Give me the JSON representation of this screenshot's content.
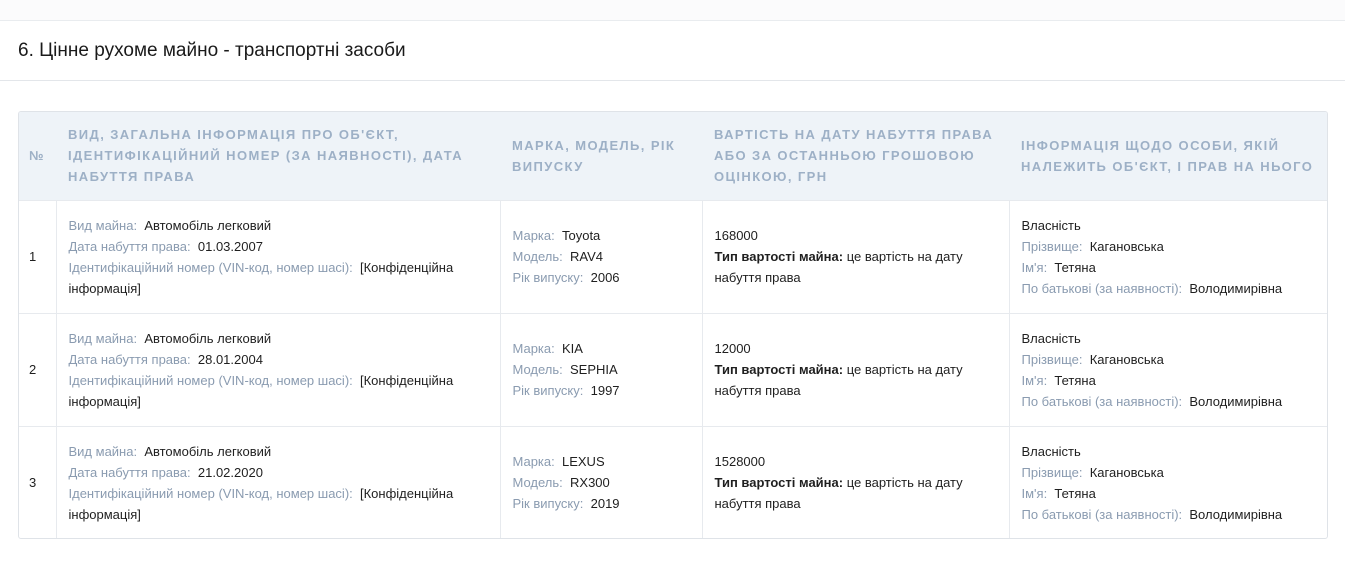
{
  "section": {
    "title": "6. Цінне рухоме майно - транспортні засоби"
  },
  "table": {
    "headers": {
      "num": "№",
      "info": "ВИД, ЗАГАЛЬНА ІНФОРМАЦІЯ ПРО ОБ'ЄКТ, ІДЕНТИФІКАЦІЙНИЙ НОМЕР (ЗА НАЯВНОСТІ), ДАТА НАБУТТЯ ПРАВА",
      "model": "МАРКА, МОДЕЛЬ, РІК ВИПУСКУ",
      "value": "ВАРТІСТЬ НА ДАТУ НАБУТТЯ ПРАВА АБО ЗА ОСТАННЬОЮ ГРОШОВОЮ ОЦІНКОЮ, ГРН",
      "owner": "ІНФОРМАЦІЯ ЩОДО ОСОБИ, ЯКІЙ НАЛЕЖИТЬ ОБ'ЄКТ, І ПРАВ НА НЬОГО"
    },
    "labels": {
      "kind": "Вид майна:",
      "date": "Дата набуття права:",
      "vin": "Ідентифікаційний номер (VIN-код, номер шасі):",
      "make": "Марка:",
      "model": "Модель:",
      "year": "Рік випуску:",
      "value_type": "Тип вартості майна:",
      "surname": "Прізвище:",
      "name": "Ім'я:",
      "patronymic": "По батькові (за наявності):"
    },
    "rows": [
      {
        "num": "1",
        "kind": "Автомобіль легковий",
        "date": "01.03.2007",
        "vin": "[Конфіденційна інформація]",
        "make": "Toyota",
        "model": "RAV4",
        "year": "2006",
        "value": "168000",
        "value_type": "це вартість на дату набуття права",
        "right": "Власність",
        "surname": "Кагановська",
        "name": "Тетяна",
        "patronymic": "Володимирівна"
      },
      {
        "num": "2",
        "kind": "Автомобіль легковий",
        "date": "28.01.2004",
        "vin": "[Конфіденційна інформація]",
        "make": "KIA",
        "model": "SEPHIA",
        "year": "1997",
        "value": "12000",
        "value_type": "це вартість на дату набуття права",
        "right": "Власність",
        "surname": "Кагановська",
        "name": "Тетяна",
        "patronymic": "Володимирівна"
      },
      {
        "num": "3",
        "kind": "Автомобіль легковий",
        "date": "21.02.2020",
        "vin": "[Конфіденційна інформація]",
        "make": "LEXUS",
        "model": "RX300",
        "year": "2019",
        "value": "1528000",
        "value_type": "це вартість на дату набуття права",
        "right": "Власність",
        "surname": "Кагановська",
        "name": "Тетяна",
        "patronymic": "Володимирівна"
      }
    ]
  }
}
